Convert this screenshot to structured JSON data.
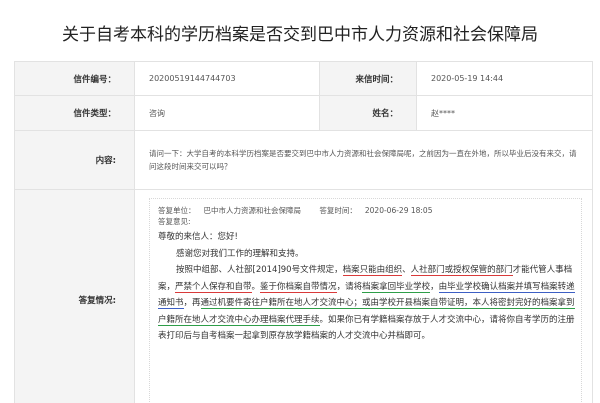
{
  "page": {
    "title": "关于自考本科的学历档案是否交到巴中市人力资源和社会保障局"
  },
  "letter": {
    "number_label": "信件编号：",
    "number_value": "20200519144744703",
    "date_label": "来信时间：",
    "date_value": "2020-05-19 14:44",
    "type_label": "信件类型：",
    "type_value": "咨询",
    "name_label": "姓名：",
    "name_value": "赵****",
    "content_label": "内容:",
    "content_value": "请问一下：大学自考的本科学历档案是否要交到巴中市人力资源和社会保障局呢，之前因为一直在外地，所以毕业后没有来交，请问这段时间来交可以吗？"
  },
  "reply": {
    "label": "答复情况:",
    "unit_label": "答复单位：",
    "unit_value": "巴中市人力资源和社会保障局",
    "time_label": "答复时间：",
    "time_value": "2020-06-29 18:05",
    "opinion_label": "答复意见:",
    "greeting": "尊敬的来信人：您好!",
    "thanks": "感谢您对我们工作的理解和支持。",
    "segments": {
      "s1": "按照中组部、人社部[2014]90号文件规定，",
      "s2": "档案只能由组织",
      "s3": "、",
      "s4": "人社部门或授权保管的部门",
      "s5": "才能代管人事档案，",
      "s6": "严禁个人保存和自带",
      "s7": "。",
      "s8": "鉴于你档案自带情况",
      "s9": "，请将",
      "s10": "档案拿回毕业学校",
      "s11": "，",
      "s12": "由毕业学校确认档案并填写档案转递通知书",
      "s13": "，再",
      "s14": "通过机要件寄往户籍所在地人才交流中心",
      "s15": "；或由学校开县档案自带证明，本人将密封完好的档案拿到户籍所在地人才交流中心办理档案代理手续",
      "s16": "。如果你已有学籍档案存放于人才交流中心，请将你自考学历的注册表打印后与自考档案一起拿到原存放学籍档案的人才交流中心并档即可。"
    }
  },
  "colors": {
    "underline_red": "#d93a3a",
    "underline_green": "#2e9e48",
    "underline_blue": "#3d5fc4",
    "label_bg": "#f4f4f4",
    "border": "#e2e2e2"
  }
}
